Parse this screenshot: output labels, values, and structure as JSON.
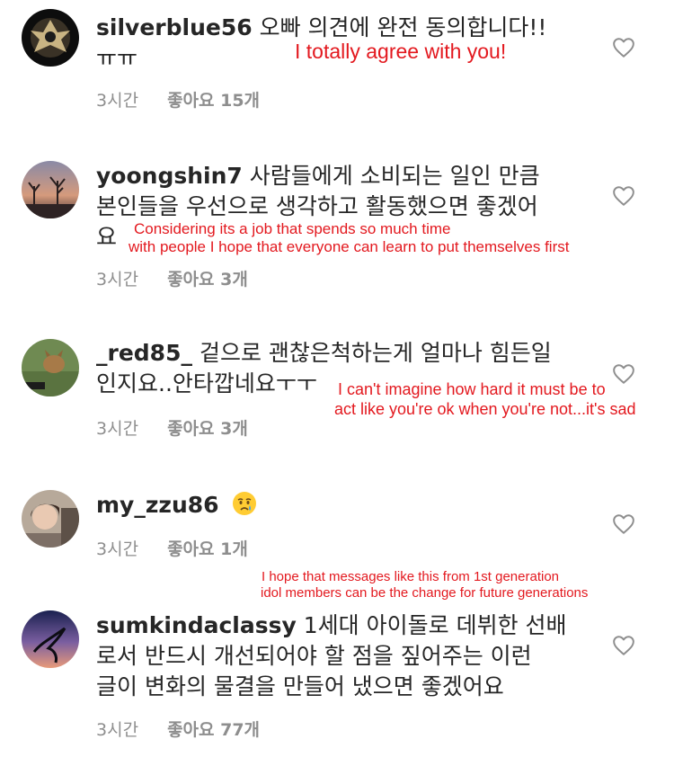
{
  "comments": [
    {
      "username": "silverblue56",
      "line1": "오빠 의견에 완전 동의합니다!!",
      "line2": "ㅠㅠ",
      "time": "3시간",
      "likes": "좋아요 15개",
      "translation": [
        "I totally agree with you!"
      ]
    },
    {
      "username": "yoongshin7",
      "line1": "사람들에게 소비되는 일인 만큼",
      "line2": "본인들을 우선으로 생각하고 활동했으면 좋겠어",
      "line3": "요",
      "time": "3시간",
      "likes": "좋아요 3개",
      "translation": [
        "Considering its a job that spends so much time",
        "with people I hope that everyone can learn to put themselves first"
      ]
    },
    {
      "username": "_red85_",
      "line1": "겉으로 괜찮은척하는게 얼마나 힘든일",
      "line2": "인지요..안타깝네요ㅜㅜ",
      "time": "3시간",
      "likes": "좋아요 3개",
      "translation": [
        "I can't imagine how hard it must be to",
        "act like you're ok when you're not...it's sad"
      ]
    },
    {
      "username": "my_zzu86",
      "emoji": "crying-face",
      "time": "3시간",
      "likes": "좋아요 1개",
      "translation": [
        "I hope that messages like this from 1st generation",
        "idol members can be the change for future generations"
      ]
    },
    {
      "username": "sumkindaclassy",
      "line1": "1세대 아이돌로 데뷔한 선배",
      "line2": "로서 반드시 개선되어야 할 점을 짚어주는 이런",
      "line3": "글이 변화의 물결을 만들어 냈으면 좋겠어요",
      "time": "3시간",
      "likes": "좋아요 77개"
    }
  ],
  "colors": {
    "annotation": "#e3191f",
    "meta": "#8e8e8e",
    "text": "#262626"
  },
  "icons": {
    "like": "heart-outline-icon"
  }
}
